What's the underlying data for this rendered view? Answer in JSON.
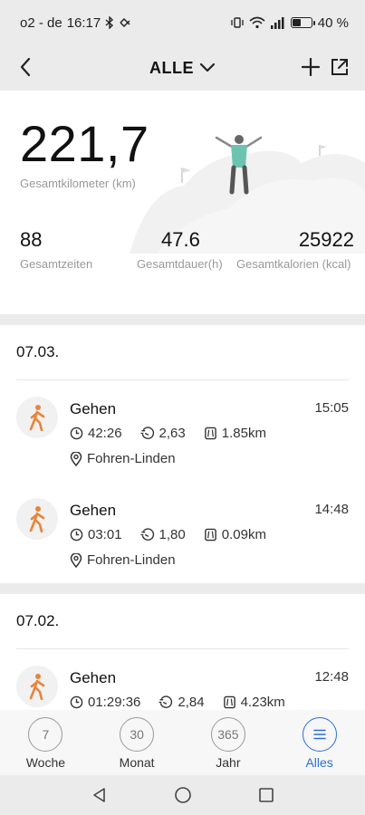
{
  "status": {
    "carrier": "o2 - de",
    "time": "16:17",
    "battery": "40 %",
    "battery_level": 0.4
  },
  "header": {
    "title": "ALLE"
  },
  "summary": {
    "total_km": "221,7",
    "total_km_label": "Gesamtkilometer (km)",
    "stats": [
      {
        "value": "88",
        "label": "Gesamtzeiten"
      },
      {
        "value": "47.6",
        "label": "Gesamtdauer(h)"
      },
      {
        "value": "25922",
        "label": "Gesamtkalorien (kcal)"
      }
    ]
  },
  "groups": [
    {
      "date": "07.03.",
      "activities": [
        {
          "name": "Gehen",
          "time": "15:05",
          "duration": "42:26",
          "pace": "2,63",
          "distance": "1.85km",
          "location": "Fohren-Linden"
        },
        {
          "name": "Gehen",
          "time": "14:48",
          "duration": "03:01",
          "pace": "1,80",
          "distance": "0.09km",
          "location": "Fohren-Linden"
        }
      ]
    },
    {
      "date": "07.02.",
      "activities": [
        {
          "name": "Gehen",
          "time": "12:48",
          "duration": "01:29:36",
          "pace": "2,84",
          "distance": "4.23km",
          "location": ""
        }
      ]
    }
  ],
  "tabs": [
    {
      "num": "7",
      "label": "Woche"
    },
    {
      "num": "30",
      "label": "Monat"
    },
    {
      "num": "365",
      "label": "Jahr"
    },
    {
      "num": "",
      "label": "Alles"
    }
  ],
  "active_tab": 3,
  "colors": {
    "accent": "#2b6fd6",
    "activity_icon": "#e8843c"
  }
}
